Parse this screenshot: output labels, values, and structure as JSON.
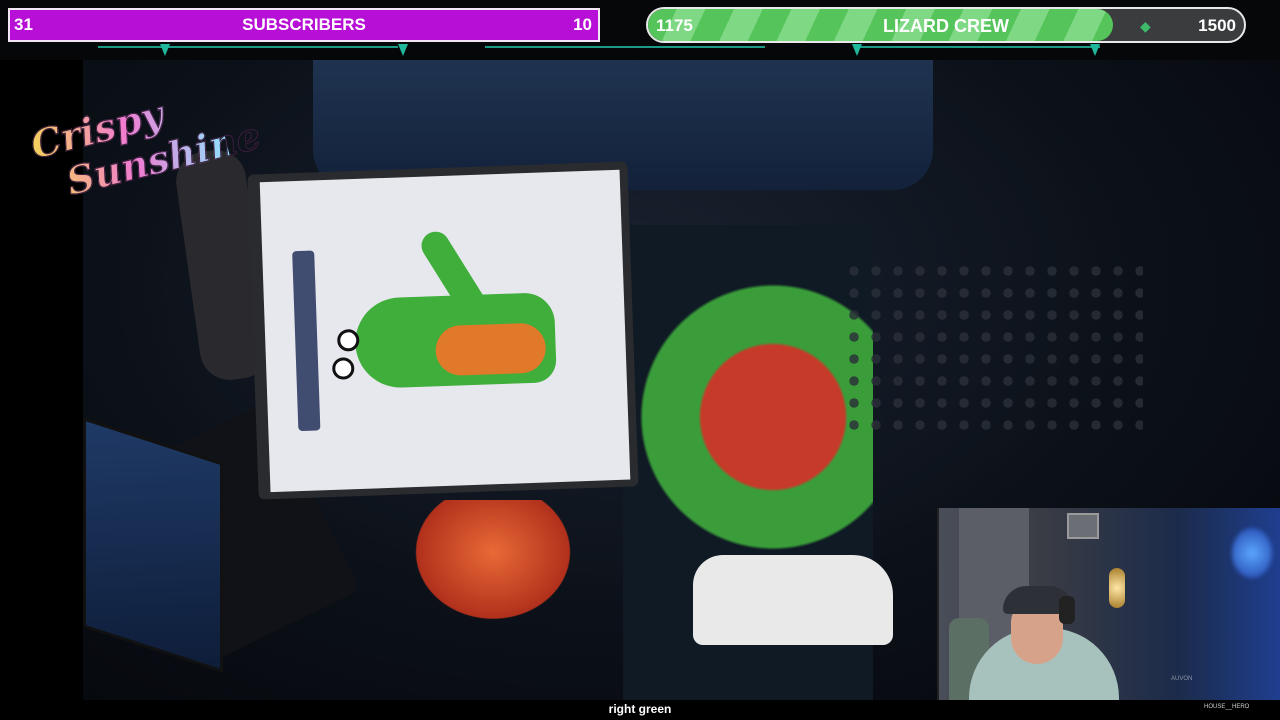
{
  "subscriber_goal": {
    "current": "31",
    "title": "SUBSCRIBERS",
    "target": "10",
    "color": "#b70fd6"
  },
  "crew_goal": {
    "current": "1175",
    "title": "LIZARD CREW",
    "target": "1500",
    "progress_fraction": 0.78,
    "color": "#55c45a"
  },
  "logo": {
    "line1": "Crispy",
    "line2": "Sunshine"
  },
  "webcam": {
    "tag": "AUVON"
  },
  "caption": "right green",
  "bottom_tag": "HOUSE__HERO",
  "icons": {
    "goal_gem": "diamond-icon"
  }
}
